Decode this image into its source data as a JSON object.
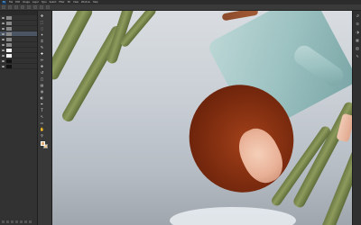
{
  "app": {
    "logo_text": "Ps"
  },
  "menubar": {
    "items": [
      "File",
      "Edit",
      "Image",
      "Layer",
      "Type",
      "Select",
      "Filter",
      "3D",
      "View",
      "Window",
      "Help"
    ]
  },
  "optionsbar": {
    "items": [
      "",
      "",
      "",
      "",
      "",
      "",
      "",
      ""
    ]
  },
  "layers_panel": {
    "header": "",
    "layers": [
      {
        "name": "",
        "thumb": "grey",
        "selected": false
      },
      {
        "name": "",
        "thumb": "grey",
        "selected": false
      },
      {
        "name": "",
        "thumb": "grey",
        "selected": false
      },
      {
        "name": "",
        "thumb": "grey",
        "selected": true
      },
      {
        "name": "",
        "thumb": "grey",
        "selected": false
      },
      {
        "name": "",
        "thumb": "grey",
        "selected": false
      },
      {
        "name": "",
        "thumb": "white",
        "selected": false
      },
      {
        "name": "",
        "thumb": "white",
        "selected": false
      },
      {
        "name": "",
        "thumb": "dark",
        "selected": false
      },
      {
        "name": "",
        "thumb": "dark",
        "selected": false
      }
    ]
  },
  "tools": [
    "move-icon",
    "marquee-icon",
    "lasso-icon",
    "magic-wand-icon",
    "crop-icon",
    "eyedropper-icon",
    "healing-icon",
    "brush-icon",
    "stamp-icon",
    "history-brush-icon",
    "eraser-icon",
    "gradient-icon",
    "blur-icon",
    "dodge-icon",
    "pen-icon",
    "type-icon",
    "path-select-icon",
    "shape-icon",
    "hand-icon",
    "zoom-icon"
  ],
  "swatches": {
    "foreground": "#e8a86a",
    "background": "#f0c89a"
  },
  "right_panel": [
    "history-icon",
    "properties-icon",
    "adjustments-icon",
    "swatches-icon",
    "channels-icon",
    "paths-icon"
  ],
  "canvas": {
    "description_colors": {
      "sky": "#c9cfd5",
      "hair": "#a3411a",
      "dress": "#9cc2c1",
      "cactus": "#6c7a44"
    }
  }
}
